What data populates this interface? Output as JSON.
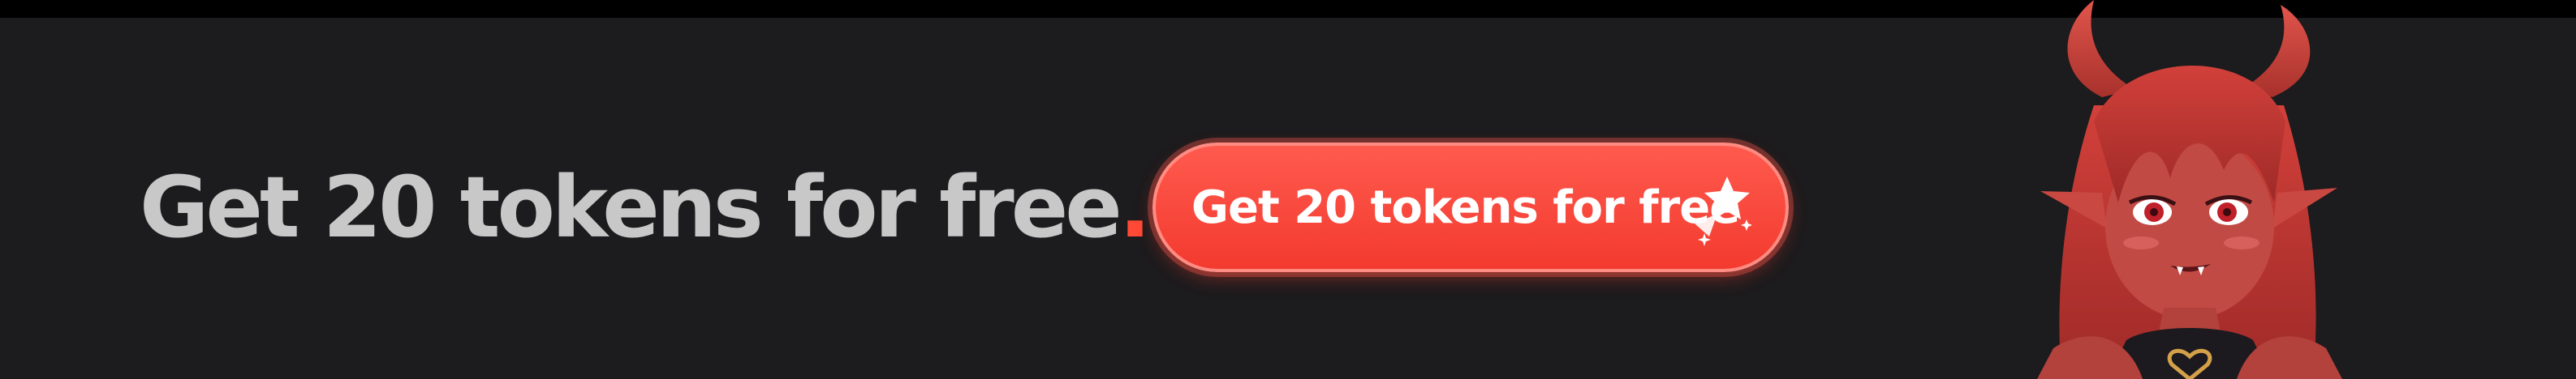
{
  "banner": {
    "headline": "Get 20 tokens for free",
    "headline_dot": ".",
    "cta_label": "Get 20 tokens for free",
    "cta_icon": "sparkle-star-icon",
    "character": "demon-girl-illustration"
  },
  "colors": {
    "background": "#1c1b1d",
    "headline_text": "#c8c8c8",
    "accent": "#ff4a36",
    "cta_background": "#f8463b",
    "cta_text": "#ffffff"
  }
}
